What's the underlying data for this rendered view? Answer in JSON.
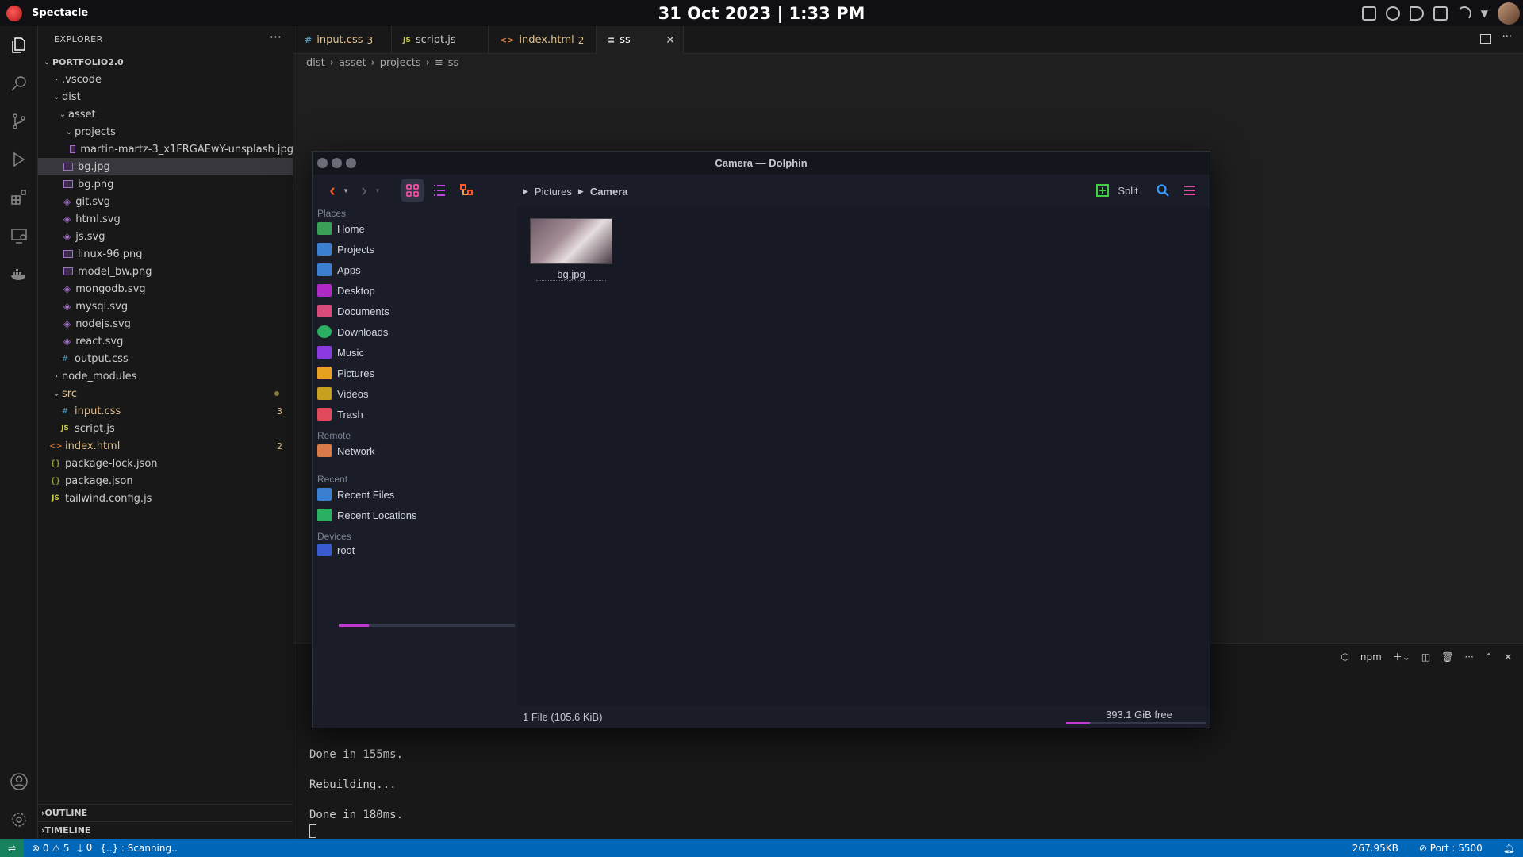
{
  "topbar": {
    "app_name": "Spectacle",
    "clock": "31 Oct 2023 | 1:33 PM"
  },
  "explorer": {
    "header": "EXPLORER",
    "more": "···",
    "root": "PORTFOLIO2.0",
    "items": [
      {
        "label": ".vscode"
      },
      {
        "label": "dist"
      },
      {
        "label": "asset"
      },
      {
        "label": "projects"
      },
      {
        "label": "martin-martz-3_x1FRGAEwY-unsplash.jpg"
      },
      {
        "label": "bg.jpg"
      },
      {
        "label": "bg.png"
      },
      {
        "label": "git.svg"
      },
      {
        "label": "html.svg"
      },
      {
        "label": "js.svg"
      },
      {
        "label": "linux-96.png"
      },
      {
        "label": "model_bw.png"
      },
      {
        "label": "mongodb.svg"
      },
      {
        "label": "mysql.svg"
      },
      {
        "label": "nodejs.svg"
      },
      {
        "label": "react.svg"
      },
      {
        "label": "output.css"
      },
      {
        "label": "node_modules"
      },
      {
        "label": "src"
      },
      {
        "label": "input.css",
        "badge": "3"
      },
      {
        "label": "script.js"
      },
      {
        "label": "index.html",
        "badge": "2"
      },
      {
        "label": "package-lock.json"
      },
      {
        "label": "package.json"
      },
      {
        "label": "tailwind.config.js"
      }
    ],
    "outline": "OUTLINE",
    "timeline": "TIMELINE"
  },
  "tabs": [
    {
      "icon": "#",
      "label": "input.css",
      "badge": "3"
    },
    {
      "icon": "JS",
      "label": "script.js",
      "badge": ""
    },
    {
      "icon": "<>",
      "label": "index.html",
      "badge": "2"
    },
    {
      "icon": "≡",
      "label": "ss",
      "badge": ""
    }
  ],
  "breadcrumb": [
    "dist",
    "asset",
    "projects",
    "ss"
  ],
  "terminal": {
    "lines": [
      "Done in 155ms.",
      "Rebuilding...",
      "Done in 180ms."
    ],
    "shell_label": "npm"
  },
  "statusbar": {
    "errors": "0",
    "warnings": "5",
    "ports": "0",
    "scanning": "{..} : Scanning..",
    "size": "267.95KB",
    "port": "Port : 5500"
  },
  "dolphin": {
    "title": "Camera — Dolphin",
    "split_label": "Split",
    "crumbs": [
      "Pictures",
      "Camera"
    ],
    "places": {
      "header": "Places",
      "items": [
        "Home",
        "Projects",
        "Apps",
        "Desktop",
        "Documents",
        "Downloads",
        "Music",
        "Pictures",
        "Videos",
        "Trash"
      ]
    },
    "remote": {
      "header": "Remote",
      "items": [
        "Network"
      ]
    },
    "recent": {
      "header": "Recent",
      "items": [
        "Recent Files",
        "Recent Locations"
      ]
    },
    "devices": {
      "header": "Devices",
      "items": [
        "root"
      ],
      "root_usage": 0.17
    },
    "file": {
      "name": "bg.jpg"
    },
    "status_left": "1 File (105.6 KiB)",
    "status_right": "393.1 GiB free",
    "free_fraction": 0.17
  },
  "colors": {
    "accent": "#0066b8",
    "modified": "#e2c08d",
    "dolphin_bg": "#1a1d28",
    "usage_bar": "#c03ad0"
  }
}
